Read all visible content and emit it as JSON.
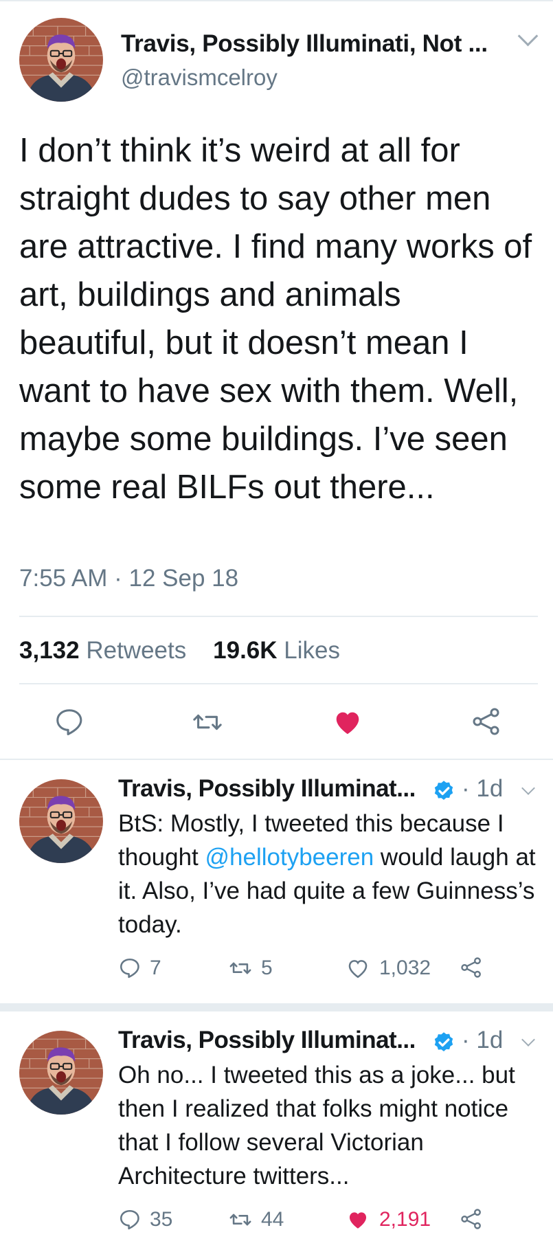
{
  "main_tweet": {
    "display_name": "Travis, Possibly Illuminati, Not ...",
    "handle": "@travismcelroy",
    "text": "I don’t think it’s weird at all for straight dudes to say other men are attractive. I find many works of art, buildings and animals beautiful, but it doesn’t mean I want to have sex with them. Well, maybe some buildings. I’ve seen some real BILFs out there...",
    "timestamp": "7:55 AM · 12 Sep 18",
    "retweet_count": "3,132",
    "retweet_label": "Retweets",
    "like_count": "19.6K",
    "like_label": "Likes",
    "liked": true
  },
  "replies": [
    {
      "display_name": "Travis, Possibly Illuminat...",
      "verified": true,
      "age": "· 1d",
      "text_before": "BtS: Mostly, I tweeted this because I thought ",
      "mention": "@hellotybeeren",
      "text_after": " would laugh at it. Also, I’ve had quite a few Guinness’s today.",
      "reply_count": "7",
      "retweet_count": "5",
      "like_count": "1,032",
      "liked": false
    },
    {
      "display_name": "Travis, Possibly Illuminat...",
      "verified": true,
      "age": "· 1d",
      "text": "Oh no... I tweeted this as a joke... but then I realized that folks might notice that I follow several Victorian Architecture twitters...",
      "reply_count": "35",
      "retweet_count": "44",
      "like_count": "2,191",
      "liked": true
    }
  ],
  "colors": {
    "accent_blue": "#1da1f2",
    "like_red": "#e0245e",
    "secondary_text": "#657786",
    "divider": "#e6ecf0"
  },
  "icons": {
    "reply": "speech-bubble-icon",
    "retweet": "retweet-arrows-icon",
    "like": "heart-icon",
    "share": "share-nodes-icon",
    "menu": "chevron-down-icon",
    "verified": "verified-badge-icon"
  }
}
